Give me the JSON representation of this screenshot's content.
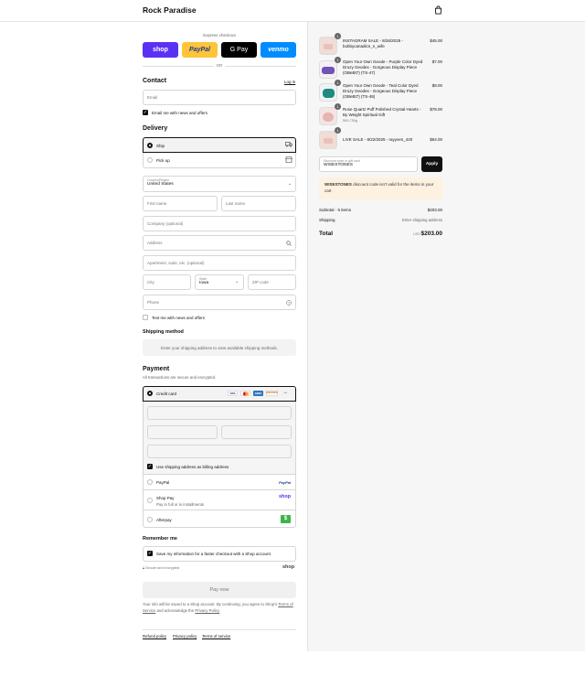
{
  "store": {
    "name": "Rock Paradise"
  },
  "express": {
    "label": "Express checkout",
    "or": "OR",
    "buttons": [
      {
        "label": "shop",
        "color": "#5a31f4"
      },
      {
        "label": "PayPal",
        "color": "#ffc439"
      },
      {
        "label": "G Pay",
        "color": "#000000"
      },
      {
        "label": "venmo",
        "color": "#008cff"
      }
    ]
  },
  "contact": {
    "title": "Contact",
    "login": "Log in",
    "email_placeholder": "Email",
    "news_label": "Email me with news and offers"
  },
  "delivery": {
    "title": "Delivery",
    "ship_label": "Ship",
    "pickup_label": "Pick up",
    "country_label": "Country/Region",
    "country_value": "United States",
    "first_name": "First name",
    "last_name": "Last name",
    "company": "Company (optional)",
    "address": "Address",
    "apartment": "Apartment, suite, etc. (optional)",
    "city": "City",
    "state_label": "State",
    "state_value": "Iowa",
    "zip": "ZIP code",
    "phone": "Phone",
    "text_label": "Text me with news and offers"
  },
  "shipping_method": {
    "title": "Shipping method",
    "message": "Enter your shipping address to view available shipping methods."
  },
  "payment": {
    "title": "Payment",
    "subtitle": "All transactions are secure and encrypted.",
    "credit_card": "Credit card",
    "card_brands": [
      "VISA",
      "MC",
      "AMEX",
      "DISCOVER"
    ],
    "billing_label": "Use shipping address as billing address",
    "paypal": "PayPal",
    "paypal_logo": "PayPal",
    "shop_pay": "Shop Pay",
    "shop_pay_sub": "Pay in full or in installments",
    "shop_pay_logo": "shop",
    "afterpay": "Afterpay"
  },
  "remember": {
    "title": "Remember me",
    "save_label": "Save my information for a faster checkout with a Shop account",
    "secure": "Secure and encrypted",
    "shop_logo": "shop"
  },
  "pay_now": "Pay now",
  "disclaimer": {
    "text1": "Your info will be saved to a Shop account. By continuing, you agree to Shop's",
    "terms": "Terms of Service",
    "and": "and acknowledge the",
    "privacy": "Privacy Policy"
  },
  "footer": {
    "refund": "Refund policy",
    "privacy": "Privacy policy",
    "terms": "Terms of service"
  },
  "order": {
    "items": [
      {
        "qty": "1",
        "name": "INSTAGRAM SALE - 8/26/2025 - bobbycanadicn_n_wife",
        "variant": "",
        "price": "$45.00"
      },
      {
        "qty": "1",
        "name": "Open Your Own Geode - Purple Color Dyed Druzy Geodes - Gorgeous Display Piece (OBeBt7) (TS-47)",
        "variant": "",
        "price": "$7.00"
      },
      {
        "qty": "1",
        "name": "Open Your Own Geode - Teal Color Dyed Druzy Geodes - Gorgeous Display Piece (OBeBt7) (TS-48)",
        "variant": "",
        "price": "$9.00"
      },
      {
        "qty": "1",
        "name": "Rose Quartz Puff Polished Crystal Hearts - By Weight Spiritual Gift",
        "variant": "500-750g",
        "price": "$78.00"
      },
      {
        "qty": "1",
        "name": "LIVE SALE - 8/22/2025 - rayyven_420",
        "variant": "",
        "price": "$64.00"
      }
    ],
    "discount_label": "Discount code or gift card",
    "discount_value": "WISESTONES",
    "apply": "Apply",
    "warning_code": "WISESTONES",
    "warning_text": "discount code isn't valid for the items in your cart",
    "subtotal_label": "Subtotal · 5 items",
    "subtotal_value": "$203.00",
    "shipping_label": "Shipping",
    "shipping_value": "Enter shipping address",
    "total_label": "Total",
    "currency": "USD",
    "total_value": "$203.00"
  }
}
